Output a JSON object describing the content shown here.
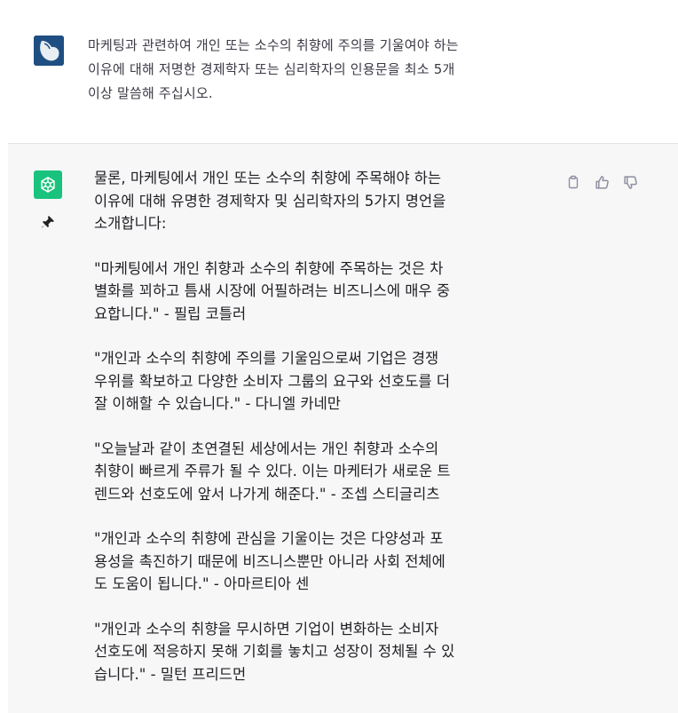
{
  "user_message": {
    "lines": [
      "마케팅과 관련하여 개인 또는 소수의 취향에 주의를 기울여야 하는",
      "이유에 대해 저명한 경제학자 또는 심리학자의 인용문을 최소 5개",
      "이상 말씀해 주십시오."
    ]
  },
  "assistant_message": {
    "intro_lines": [
      "물론, 마케팅에서 개인 또는 소수의 취향에 주목해야 하는",
      "이유에 대해 유명한 경제학자 및 심리학자의 5가지 명언을",
      "소개합니다:"
    ],
    "quotes": [
      {
        "lines": [
          "\"마케팅에서 개인 취향과 소수의 취향에 주목하는 것은 차",
          "별화를 꾀하고 틈새 시장에 어필하려는 비즈니스에 매우 중",
          "요합니다.\" - 필립 코틀러"
        ]
      },
      {
        "lines": [
          "\"개인과 소수의 취향에 주의를 기울임으로써 기업은 경쟁",
          "우위를 확보하고 다양한 소비자 그룹의 요구와 선호도를 더",
          "잘 이해할 수 있습니다.\" - 다니엘 카네만"
        ]
      },
      {
        "lines": [
          "\"오늘날과 같이 초연결된 세상에서는 개인 취향과 소수의",
          "취향이 빠르게 주류가 될 수 있다. 이는 마케터가 새로운 트",
          "렌드와 선호도에 앞서 나가게 해준다.\" - 조셉 스티글리츠"
        ]
      },
      {
        "lines": [
          "\"개인과 소수의 취향에 관심을 기울이는 것은 다양성과 포",
          "용성을 촉진하기 때문에 비즈니스뿐만 아니라 사회 전체에",
          "도 도움이 됩니다.\" - 아마르티아 센"
        ]
      },
      {
        "lines": [
          "\"개인과 소수의 취향을 무시하면 기업이 변화하는 소비자",
          "선호도에 적응하지 못해 기회를 놓치고 성장이 정체될 수 있",
          "습니다.\" - 밀턴 프리드먼"
        ]
      }
    ]
  },
  "icons": {
    "user_avatar": "user-avatar-icon",
    "assistant_avatar": "openai-logo-icon",
    "pin": "pin-icon",
    "copy": "clipboard-icon",
    "thumbs_up": "thumbs-up-icon",
    "thumbs_down": "thumbs-down-icon"
  },
  "colors": {
    "assistant_bg": "#f7f7f8",
    "gpt_green": "#19c37d",
    "user_avatar_bg": "#1f4f82"
  }
}
